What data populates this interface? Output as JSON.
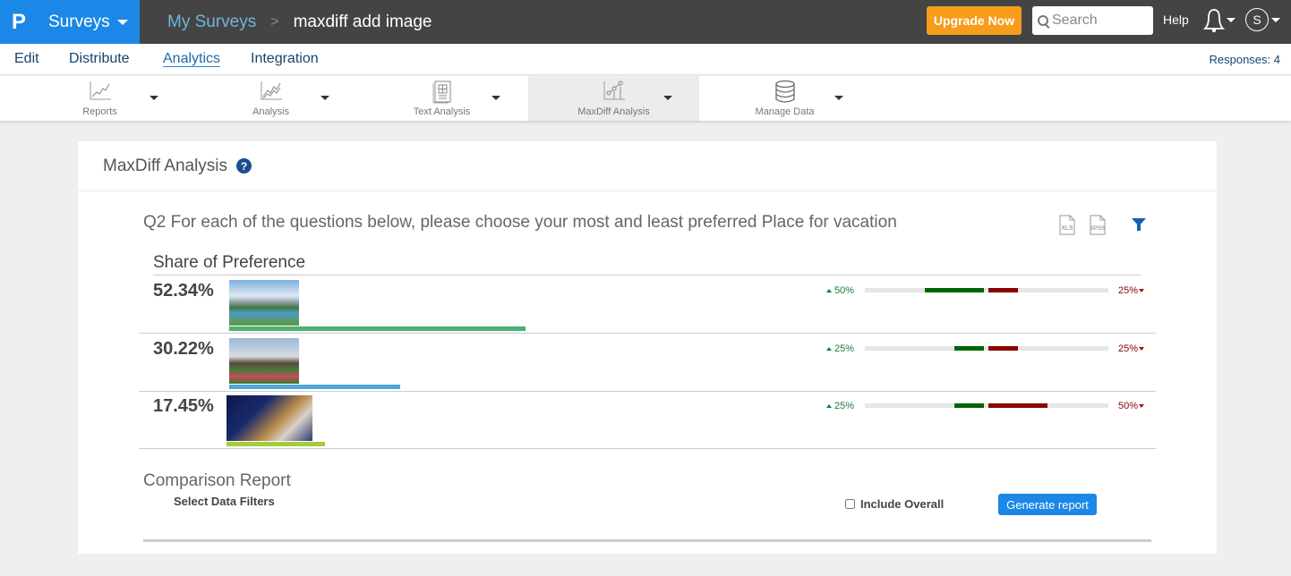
{
  "topbar": {
    "logo": "P",
    "product": "Surveys",
    "breadcrumb_parent": "My Surveys",
    "breadcrumb_sep": ">",
    "survey_title": "maxdiff add image",
    "upgrade_label": "Upgrade Now",
    "search_placeholder": "Search",
    "help_label": "Help",
    "avatar_initial": "S",
    "brand_color": "#1b87e6",
    "upgrade_color": "#f79c1b"
  },
  "subnav": {
    "items": [
      {
        "label": "Edit"
      },
      {
        "label": "Distribute"
      },
      {
        "label": "Analytics",
        "active": true
      },
      {
        "label": "Integration"
      }
    ],
    "responses": "Responses: 4"
  },
  "toolbar": {
    "items": [
      {
        "label": "Reports",
        "icon": "line-chart-icon"
      },
      {
        "label": "Analysis",
        "icon": "multi-line-chart-icon"
      },
      {
        "label": "Text Analysis",
        "icon": "document-grid-icon"
      },
      {
        "label": "MaxDiff Analysis",
        "icon": "maxdiff-chart-icon",
        "active": true
      },
      {
        "label": "Manage Data",
        "icon": "database-icon"
      }
    ]
  },
  "panel": {
    "title": "MaxDiff Analysis",
    "help_glyph": "?",
    "question": "Q2 For each of the questions below, please choose your most and least preferred Place for vacation",
    "exports": [
      "XLS",
      "SPSS"
    ],
    "share_title": "Share of Preference",
    "rows": [
      {
        "share": "52.34%",
        "share_value": 52.34,
        "image": "mountain-lake-image",
        "bar_color": "#4caf72",
        "most": "50%",
        "most_value": 50,
        "least": "25%",
        "least_value": 25
      },
      {
        "share": "30.22%",
        "share_value": 30.22,
        "image": "bali-temple-image",
        "bar_color": "#4ea8d8",
        "most": "25%",
        "most_value": 25,
        "least": "25%",
        "least_value": 25
      },
      {
        "share": "17.45%",
        "share_value": 17.45,
        "image": "london-night-image",
        "bar_color": "#a4cc3c",
        "most": "25%",
        "most_value": 25,
        "least": "50%",
        "least_value": 50
      }
    ],
    "comparison_title": "Comparison Report",
    "comparison_sub": "Select Data Filters",
    "include_overall_label": "Include Overall",
    "include_overall_checked": false,
    "generate_label": "Generate report"
  }
}
